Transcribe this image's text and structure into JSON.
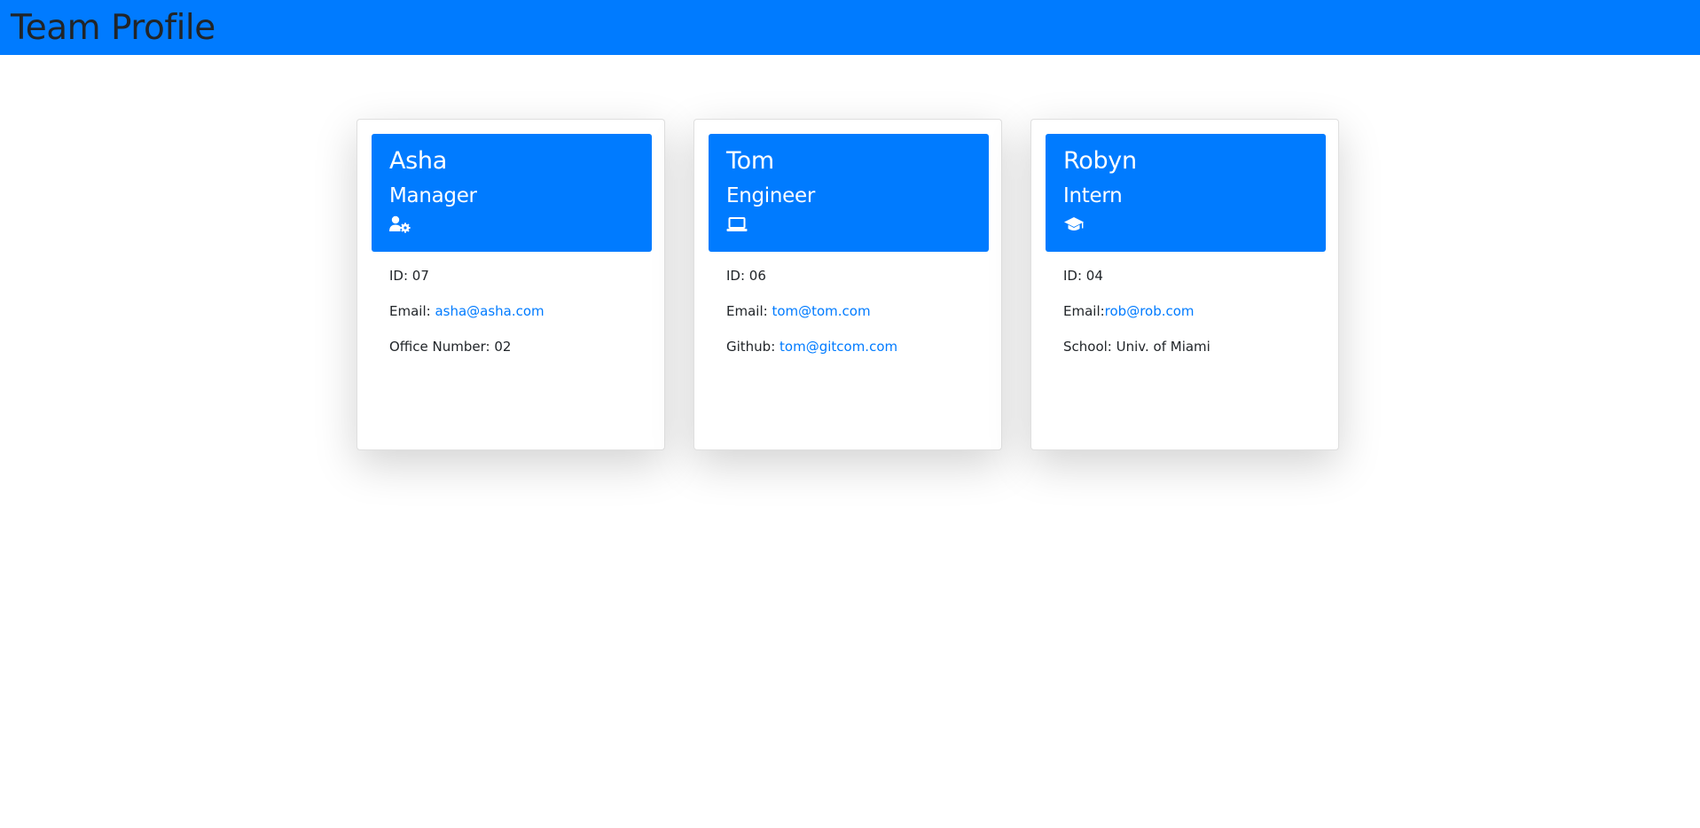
{
  "header": {
    "title": "Team Profile"
  },
  "theme": {
    "accent": "#007bff",
    "text": "#212529"
  },
  "cards": [
    {
      "name": "Asha",
      "role": "Manager",
      "icon": "user-cog-icon",
      "id_label": "ID: 07",
      "email_label": "Email: ",
      "email": "asha@asha.com",
      "extra_label": "Office Number: 02",
      "extra_link": ""
    },
    {
      "name": "Tom",
      "role": "Engineer",
      "icon": "laptop-icon",
      "id_label": "ID: 06",
      "email_label": "Email: ",
      "email": "tom@tom.com",
      "extra_label": "Github: ",
      "extra_link": "tom@gitcom.com"
    },
    {
      "name": "Robyn",
      "role": "Intern",
      "icon": "graduation-cap-icon",
      "id_label": "ID: 04",
      "email_label": "Email:",
      "email": "rob@rob.com",
      "extra_label": "School: Univ. of Miami",
      "extra_link": ""
    }
  ]
}
